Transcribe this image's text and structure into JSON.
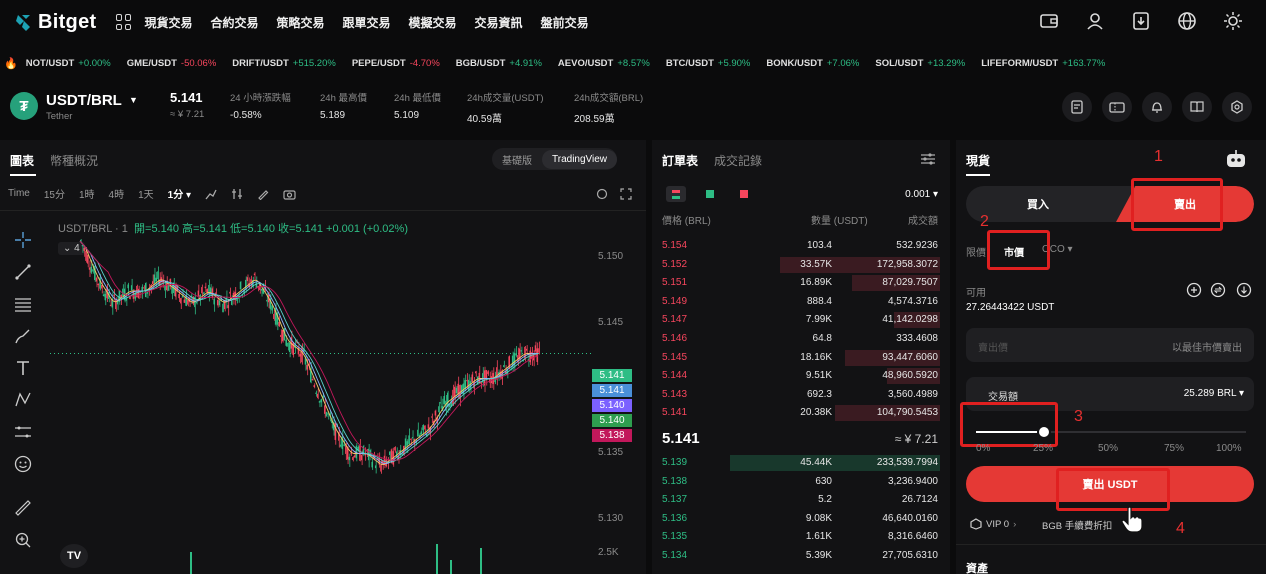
{
  "nav": {
    "logo": "Bitget",
    "menu": [
      "現貨交易",
      "合約交易",
      "策略交易",
      "跟單交易",
      "模擬交易",
      "交易資訊",
      "盤前交易"
    ]
  },
  "ticker": [
    {
      "symbol": "NOT/USDT",
      "change": "+0.00%",
      "dir": "up"
    },
    {
      "symbol": "GME/USDT",
      "change": "-50.06%",
      "dir": "down"
    },
    {
      "symbol": "DRIFT/USDT",
      "change": "+515.20%",
      "dir": "up"
    },
    {
      "symbol": "PEPE/USDT",
      "change": "-4.70%",
      "dir": "down"
    },
    {
      "symbol": "BGB/USDT",
      "change": "+4.91%",
      "dir": "up"
    },
    {
      "symbol": "AEVO/USDT",
      "change": "+8.57%",
      "dir": "up"
    },
    {
      "symbol": "BTC/USDT",
      "change": "+5.90%",
      "dir": "up"
    },
    {
      "symbol": "BONK/USDT",
      "change": "+7.06%",
      "dir": "up"
    },
    {
      "symbol": "SOL/USDT",
      "change": "+13.29%",
      "dir": "up"
    },
    {
      "symbol": "LIFEFORM/USDT",
      "change": "+163.77%",
      "dir": "up"
    }
  ],
  "pair": {
    "name": "USDT/BRL",
    "sub": "Tether",
    "price": "5.141",
    "price_sub": "≈ ¥ 7.21",
    "stats": [
      {
        "label": "24 小時漲跌幅",
        "value": "-0.58%",
        "dir": "down"
      },
      {
        "label": "24h 最高價",
        "value": "5.189",
        "dir": ""
      },
      {
        "label": "24h 最低價",
        "value": "5.109",
        "dir": ""
      },
      {
        "label": "24h成交量(USDT)",
        "value": "40.59萬",
        "dir": ""
      },
      {
        "label": "24h成交額(BRL)",
        "value": "208.59萬",
        "dir": ""
      }
    ]
  },
  "chart": {
    "tabs": [
      "圖表",
      "幣種概況"
    ],
    "views": [
      "基礎版",
      "TradingView"
    ],
    "intervals": [
      "Time",
      "15分",
      "1時",
      "4時",
      "1天",
      "1分 ▾"
    ],
    "symbol_line": "USDT/BRL · 1",
    "ohlc": "開=5.140 高=5.141 低=5.140 收=5.141 +0.001 (+0.02%)",
    "indicator": "4",
    "price_axis": [
      "5.150",
      "5.145",
      "5.135",
      "5.130"
    ],
    "price_pills": [
      {
        "v": "5.141",
        "color": "#2ebd85"
      },
      {
        "v": "5.141",
        "color": "#4a90d9"
      },
      {
        "v": "5.140",
        "color": "#7b61ff"
      },
      {
        "v": "5.140",
        "color": "#2e9e4f"
      },
      {
        "v": "5.138",
        "color": "#c2185b"
      }
    ],
    "vol_label": "2.5K",
    "tv": "TV"
  },
  "chart_data": {
    "type": "line",
    "title": "USDT/BRL · 1",
    "ylim": [
      5.128,
      5.152
    ],
    "series": [
      {
        "name": "",
        "values": [
          5.15,
          5.147,
          5.145,
          5.146,
          5.146,
          5.147,
          5.146,
          5.145,
          5.146,
          5.145,
          5.146,
          5.147,
          5.145,
          5.142,
          5.141,
          5.138,
          5.135,
          5.133,
          5.133,
          5.132,
          5.133,
          5.134,
          5.135,
          5.137,
          5.138,
          5.139,
          5.139,
          5.14,
          5.141,
          5.141
        ]
      }
    ]
  },
  "book": {
    "tabs": [
      "訂單表",
      "成交記錄"
    ],
    "precision": "0.001 ▾",
    "headers": [
      "價格 (BRL)",
      "數量 (USDT)",
      "成交額"
    ],
    "asks": [
      {
        "p": "5.154",
        "q": "103.4",
        "t": "532.9236",
        "d": 0.0
      },
      {
        "p": "5.152",
        "q": "33.57K",
        "t": "172,958.3072",
        "d": 0.76
      },
      {
        "p": "5.151",
        "q": "16.89K",
        "t": "87,029.7507",
        "d": 0.42
      },
      {
        "p": "5.149",
        "q": "888.4",
        "t": "4,574.3716",
        "d": 0.0
      },
      {
        "p": "5.147",
        "q": "7.99K",
        "t": "41,142.0298",
        "d": 0.22
      },
      {
        "p": "5.146",
        "q": "64.8",
        "t": "333.4608",
        "d": 0.0
      },
      {
        "p": "5.145",
        "q": "18.16K",
        "t": "93,447.6060",
        "d": 0.45
      },
      {
        "p": "5.144",
        "q": "9.51K",
        "t": "48,960.5920",
        "d": 0.25
      },
      {
        "p": "5.143",
        "q": "692.3",
        "t": "3,560.4989",
        "d": 0.0
      },
      {
        "p": "5.141",
        "q": "20.38K",
        "t": "104,790.5453",
        "d": 0.5
      }
    ],
    "mid": "5.141",
    "mid_sub": "≈ ¥ 7.21",
    "bids": [
      {
        "p": "5.139",
        "q": "45.44K",
        "t": "233,539.7994",
        "d": 1.0
      },
      {
        "p": "5.138",
        "q": "630",
        "t": "3,236.9400",
        "d": 0.0
      },
      {
        "p": "5.137",
        "q": "5.2",
        "t": "26.7124",
        "d": 0.0
      },
      {
        "p": "5.136",
        "q": "9.08K",
        "t": "46,640.0160",
        "d": 0.0
      },
      {
        "p": "5.135",
        "q": "1.61K",
        "t": "8,316.6460",
        "d": 0.0
      },
      {
        "p": "5.134",
        "q": "5.39K",
        "t": "27,705.6310",
        "d": 0.0
      }
    ]
  },
  "trade": {
    "tab": "現貨",
    "buy": "買入",
    "sell": "賣出",
    "order_types": [
      "限價",
      "市價",
      "OCO ▾"
    ],
    "available_label": "可用",
    "available_value": "27.26443422 USDT",
    "price_placeholder": "賣出價",
    "price_hint": "以最佳市價賣出",
    "amount_label": "交易額",
    "amount_value": "25.289 BRL ▾",
    "percents": [
      "0%",
      "25%",
      "50%",
      "75%",
      "100%"
    ],
    "slider_value": 0.25,
    "sell_button": "賣出 USDT",
    "vip": "VIP 0",
    "bgb": "BGB 手續費折扣",
    "assets": "資產"
  },
  "annotations": [
    "1",
    "2",
    "3",
    "4"
  ]
}
